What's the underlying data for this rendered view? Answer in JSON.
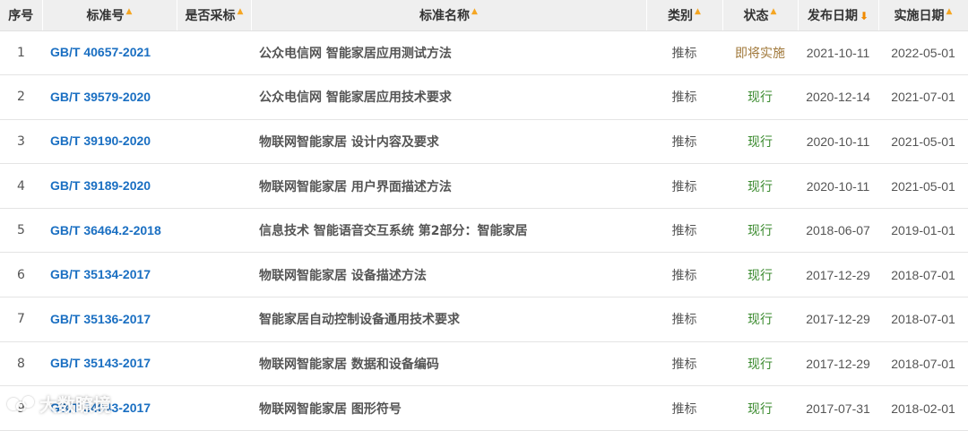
{
  "headers": {
    "index": "序号",
    "code": "标准号",
    "adopted": "是否采标",
    "name": "标准名称",
    "category": "类别",
    "status": "状态",
    "publish_date": "发布日期",
    "impl_date": "实施日期"
  },
  "sort_icons": {
    "inactive": "caret-up-icon",
    "active": "arrow-down-icon"
  },
  "colors": {
    "link": "#1a6fc2",
    "status_upcoming": "#a0783a",
    "status_current": "#3a8a2e",
    "sort_arrow": "#f5a623",
    "header_bg": "#efefef"
  },
  "rows": [
    {
      "index": "1",
      "code": "GB/T 40657-2021",
      "adopted": "",
      "name": "公众电信网 智能家居应用测试方法",
      "category": "推标",
      "status": "即将实施",
      "status_type": "upcoming",
      "publish_date": "2021-10-11",
      "impl_date": "2022-05-01"
    },
    {
      "index": "2",
      "code": "GB/T 39579-2020",
      "adopted": "",
      "name": "公众电信网 智能家居应用技术要求",
      "category": "推标",
      "status": "现行",
      "status_type": "current",
      "publish_date": "2020-12-14",
      "impl_date": "2021-07-01"
    },
    {
      "index": "3",
      "code": "GB/T 39190-2020",
      "adopted": "",
      "name": "物联网智能家居 设计内容及要求",
      "category": "推标",
      "status": "现行",
      "status_type": "current",
      "publish_date": "2020-10-11",
      "impl_date": "2021-05-01"
    },
    {
      "index": "4",
      "code": "GB/T 39189-2020",
      "adopted": "",
      "name": "物联网智能家居 用户界面描述方法",
      "category": "推标",
      "status": "现行",
      "status_type": "current",
      "publish_date": "2020-10-11",
      "impl_date": "2021-05-01"
    },
    {
      "index": "5",
      "code": "GB/T 36464.2-2018",
      "adopted": "",
      "name": "信息技术 智能语音交互系统 第2部分：智能家居",
      "category": "推标",
      "status": "现行",
      "status_type": "current",
      "publish_date": "2018-06-07",
      "impl_date": "2019-01-01"
    },
    {
      "index": "6",
      "code": "GB/T 35134-2017",
      "adopted": "",
      "name": "物联网智能家居 设备描述方法",
      "category": "推标",
      "status": "现行",
      "status_type": "current",
      "publish_date": "2017-12-29",
      "impl_date": "2018-07-01"
    },
    {
      "index": "7",
      "code": "GB/T 35136-2017",
      "adopted": "",
      "name": "智能家居自动控制设备通用技术要求",
      "category": "推标",
      "status": "现行",
      "status_type": "current",
      "publish_date": "2017-12-29",
      "impl_date": "2018-07-01"
    },
    {
      "index": "8",
      "code": "GB/T 35143-2017",
      "adopted": "",
      "name": "物联网智能家居 数据和设备编码",
      "category": "推标",
      "status": "现行",
      "status_type": "current",
      "publish_date": "2017-12-29",
      "impl_date": "2018-07-01"
    },
    {
      "index": "9",
      "code": "GB/T 34043-2017",
      "adopted": "",
      "name": "物联网智能家居 图形符号",
      "category": "推标",
      "status": "现行",
      "status_type": "current",
      "publish_date": "2017-07-31",
      "impl_date": "2018-02-01"
    }
  ],
  "watermark": {
    "text": "大数瞭境"
  }
}
